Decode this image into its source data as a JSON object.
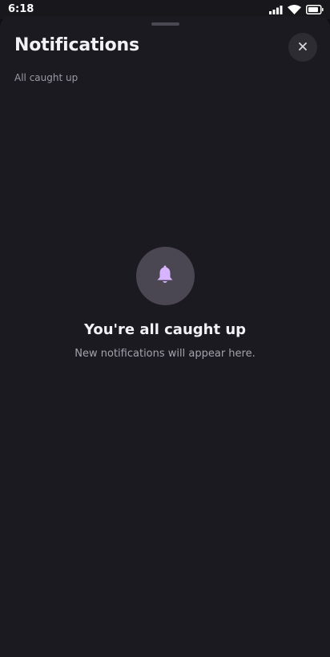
{
  "status_bar": {
    "time": "6:18",
    "icons": [
      "signal-icon",
      "wifi-icon",
      "battery-icon"
    ]
  },
  "sheet": {
    "title": "Notifications",
    "subtitle": "All caught up",
    "close_icon": "close-icon"
  },
  "empty_state": {
    "icon": "bell-icon",
    "title": "You're all caught up",
    "description": "New notifications will appear here."
  },
  "colors": {
    "background": "#1c1a21",
    "icon_circle": "#4a4652",
    "bell_accent": "#d6b4ff"
  }
}
